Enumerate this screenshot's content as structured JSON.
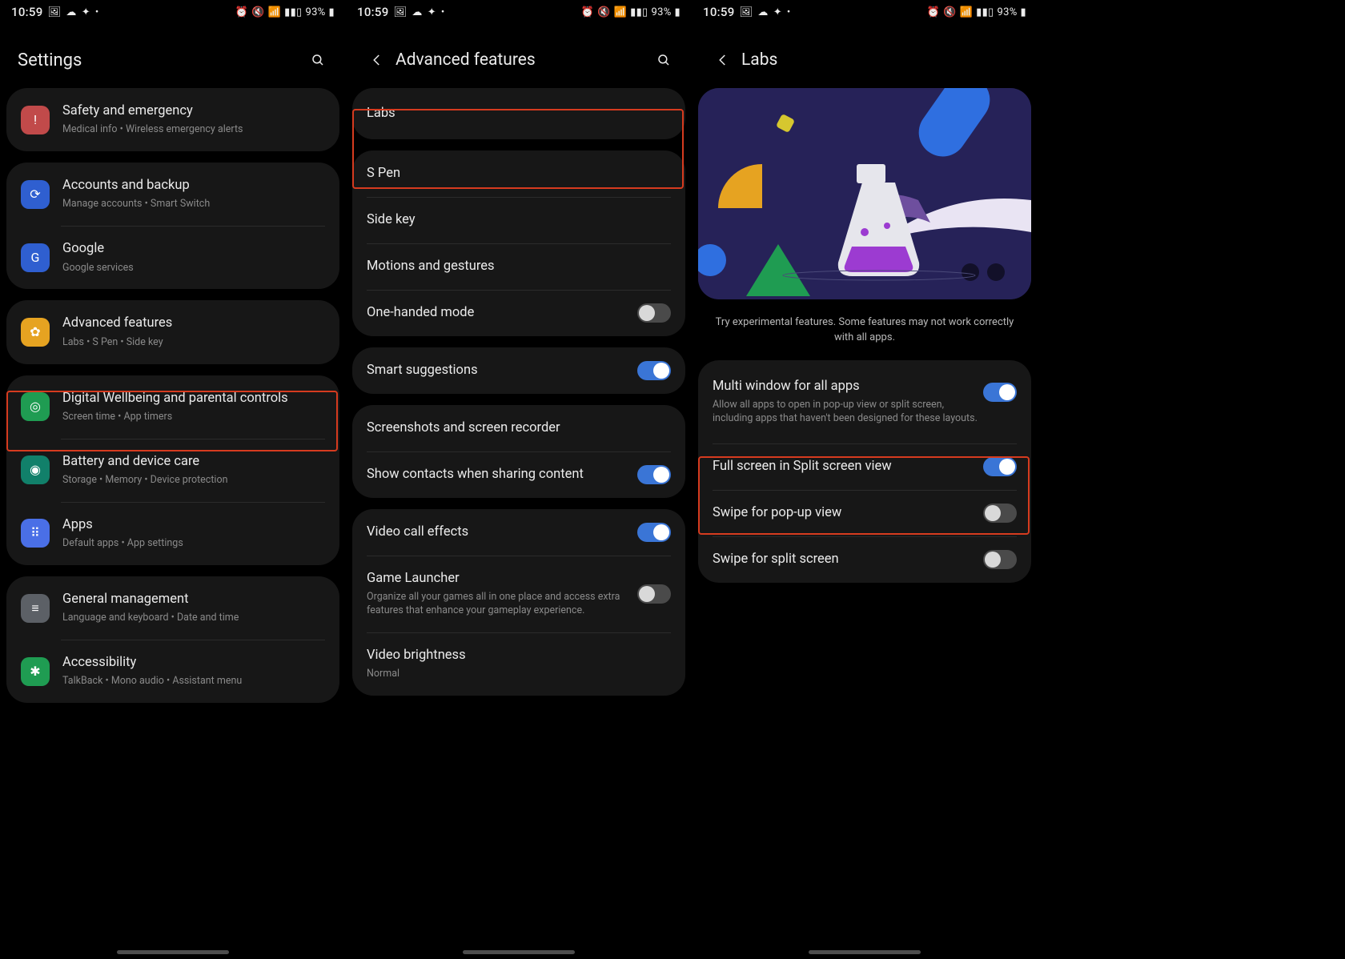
{
  "status": {
    "time": "10:59",
    "battery": "93%"
  },
  "phone1": {
    "title": "Settings",
    "items": [
      {
        "title": "Safety and emergency",
        "sub": "Medical info  •  Wireless emergency alerts"
      },
      {
        "title": "Accounts and backup",
        "sub": "Manage accounts  •  Smart Switch"
      },
      {
        "title": "Google",
        "sub": "Google services"
      },
      {
        "title": "Advanced features",
        "sub": "Labs  •  S Pen  •  Side key"
      },
      {
        "title": "Digital Wellbeing and parental controls",
        "sub": "Screen time  •  App timers"
      },
      {
        "title": "Battery and device care",
        "sub": "Storage  •  Memory  •  Device protection"
      },
      {
        "title": "Apps",
        "sub": "Default apps  •  App settings"
      },
      {
        "title": "General management",
        "sub": "Language and keyboard  •  Date and time"
      },
      {
        "title": "Accessibility",
        "sub": "TalkBack  •  Mono audio  •  Assistant menu"
      }
    ]
  },
  "phone2": {
    "title": "Advanced features",
    "items": {
      "labs": "Labs",
      "spen": "S Pen",
      "sidekey": "Side key",
      "motions": "Motions and gestures",
      "onehanded": "One-handed mode",
      "smart": "Smart suggestions",
      "screenshots": "Screenshots and screen recorder",
      "sharecontacts": "Show contacts when sharing content",
      "videocall": "Video call effects",
      "gamelauncher": {
        "t": "Game Launcher",
        "s": "Organize all your games all in one place and access extra features that enhance your gameplay experience."
      },
      "videobright": {
        "t": "Video brightness",
        "s": "Normal"
      }
    }
  },
  "phone3": {
    "title": "Labs",
    "note": "Try experimental features. Some features may not work correctly with all apps.",
    "items": {
      "multi": {
        "t": "Multi window for all apps",
        "s": "Allow all apps to open in pop-up view or split screen, including apps that haven't been designed for these layouts."
      },
      "fullscreen": "Full screen in Split screen view",
      "swipepop": "Swipe for pop-up view",
      "swipesplit": "Swipe for split screen"
    }
  }
}
